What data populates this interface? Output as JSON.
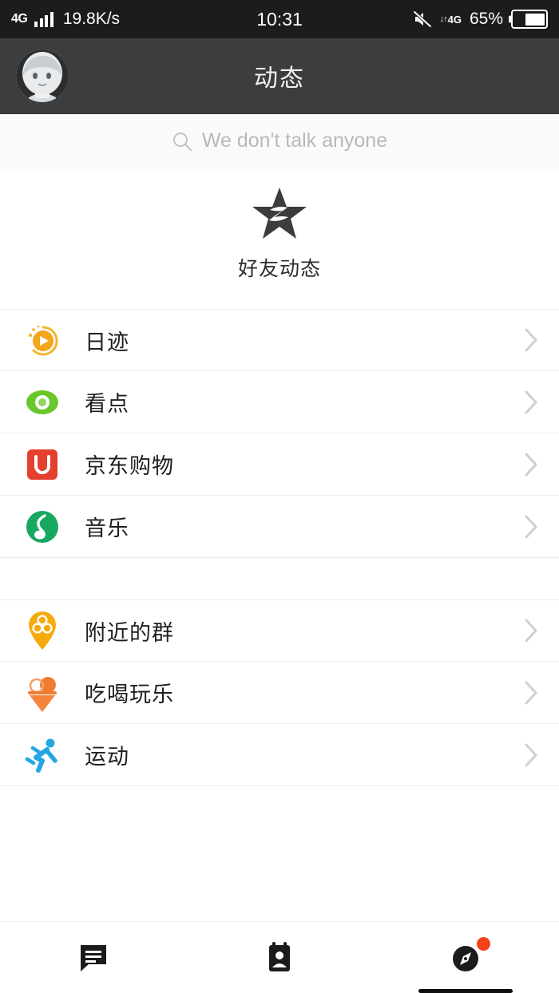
{
  "statusbar": {
    "network_type": "4G",
    "speed": "19.8K/s",
    "time": "10:31",
    "data_indicator": "4G",
    "battery_percent": "65%",
    "icons": [
      "signal-bars-icon",
      "mute-icon",
      "data-transfer-icon",
      "battery-icon"
    ]
  },
  "header": {
    "title": "动态",
    "avatar_alt": "user-avatar"
  },
  "search": {
    "placeholder": "We don't talk anyone",
    "icon": "search-icon"
  },
  "feature": {
    "label": "好友动态",
    "icon": "star-qzone-icon"
  },
  "groups": [
    {
      "items": [
        {
          "label": "日迹",
          "icon": "day-track-icon",
          "color": "#f2a61b"
        },
        {
          "label": "看点",
          "icon": "kandian-eye-icon",
          "color": "#6ac72b"
        },
        {
          "label": "京东购物",
          "icon": "jd-shopping-icon",
          "color": "#e5402e"
        },
        {
          "label": "音乐",
          "icon": "music-note-icon",
          "color": "#17a862"
        }
      ]
    },
    {
      "items": [
        {
          "label": "附近的群",
          "icon": "nearby-group-pin-icon",
          "color": "#f5ab0d"
        },
        {
          "label": "吃喝玩乐",
          "icon": "food-fun-cone-icon",
          "color": "#f07c33"
        },
        {
          "label": "运动",
          "icon": "sports-runner-icon",
          "color": "#23a7e0"
        }
      ]
    }
  ],
  "bottomnav": {
    "items": [
      {
        "name": "messages",
        "icon": "chat-bubble-icon",
        "active": false,
        "badge": false
      },
      {
        "name": "contacts",
        "icon": "contacts-card-icon",
        "active": false,
        "badge": false
      },
      {
        "name": "discover",
        "icon": "compass-icon",
        "active": true,
        "badge": true
      }
    ]
  }
}
